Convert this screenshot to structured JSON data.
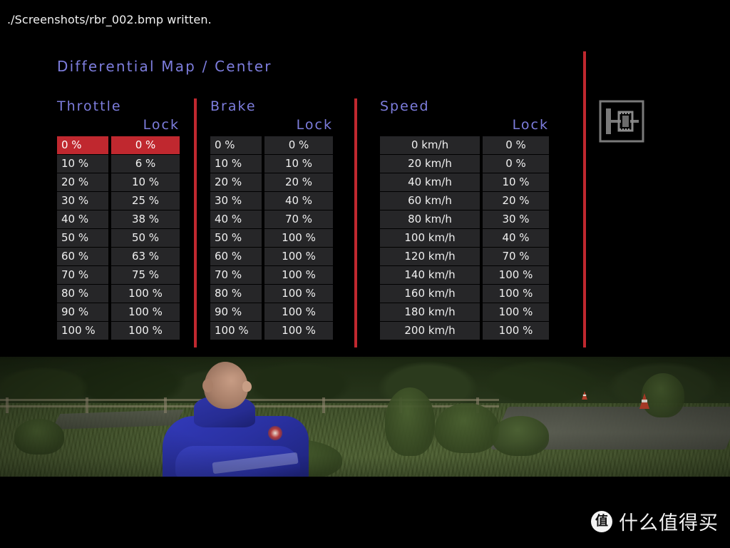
{
  "console": {
    "message": "./Screenshots/rbr_002.bmp written."
  },
  "panel": {
    "title": "Differential Map / Center",
    "icon_name": "center-differential-icon",
    "accent_red": "#c0282f",
    "title_blue": "#7d7ddd",
    "cell_bg": "#262628",
    "cell_text": "#f0f0f0"
  },
  "tables": {
    "throttle": {
      "title": "Throttle",
      "lock_label": "Lock",
      "selected_row": 0,
      "rows": [
        {
          "input": "0 %",
          "lock": "0 %"
        },
        {
          "input": "10 %",
          "lock": "6 %"
        },
        {
          "input": "20 %",
          "lock": "10 %"
        },
        {
          "input": "30 %",
          "lock": "25 %"
        },
        {
          "input": "40 %",
          "lock": "38 %"
        },
        {
          "input": "50 %",
          "lock": "50 %"
        },
        {
          "input": "60 %",
          "lock": "63 %"
        },
        {
          "input": "70 %",
          "lock": "75 %"
        },
        {
          "input": "80 %",
          "lock": "100 %"
        },
        {
          "input": "90 %",
          "lock": "100 %"
        },
        {
          "input": "100 %",
          "lock": "100 %"
        }
      ]
    },
    "brake": {
      "title": "Brake",
      "lock_label": "Lock",
      "selected_row": -1,
      "rows": [
        {
          "input": "0 %",
          "lock": "0 %"
        },
        {
          "input": "10 %",
          "lock": "10 %"
        },
        {
          "input": "20 %",
          "lock": "20 %"
        },
        {
          "input": "30 %",
          "lock": "40 %"
        },
        {
          "input": "40 %",
          "lock": "70 %"
        },
        {
          "input": "50 %",
          "lock": "100 %"
        },
        {
          "input": "60 %",
          "lock": "100 %"
        },
        {
          "input": "70 %",
          "lock": "100 %"
        },
        {
          "input": "80 %",
          "lock": "100 %"
        },
        {
          "input": "90 %",
          "lock": "100 %"
        },
        {
          "input": "100 %",
          "lock": "100 %"
        }
      ]
    },
    "speed": {
      "title": "Speed",
      "lock_label": "Lock",
      "selected_row": -1,
      "rows": [
        {
          "input": "0 km/h",
          "lock": "0 %"
        },
        {
          "input": "20 km/h",
          "lock": "0 %"
        },
        {
          "input": "40 km/h",
          "lock": "10 %"
        },
        {
          "input": "60 km/h",
          "lock": "20 %"
        },
        {
          "input": "80 km/h",
          "lock": "30 %"
        },
        {
          "input": "100 km/h",
          "lock": "40 %"
        },
        {
          "input": "120 km/h",
          "lock": "70 %"
        },
        {
          "input": "140 km/h",
          "lock": "100 %"
        },
        {
          "input": "160 km/h",
          "lock": "100 %"
        },
        {
          "input": "180 km/h",
          "lock": "100 %"
        },
        {
          "input": "200 km/h",
          "lock": "100 %"
        }
      ]
    }
  },
  "watermark": {
    "logo": "值",
    "text": "什么值得买"
  }
}
